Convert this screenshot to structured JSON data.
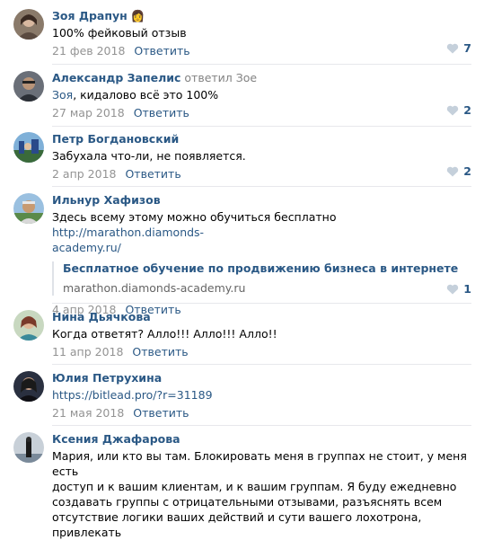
{
  "comments": [
    {
      "author": "Зоя Драпун",
      "author_emoji": "👩",
      "reply_to": "",
      "text_prefix": "",
      "text": "100% фейковый отзыв",
      "date": "21 фев 2018",
      "reply_label": "Ответить",
      "likes": "7"
    },
    {
      "author": "Александр Запелис",
      "reply_to": "ответил Зое",
      "text_prefix": "Зоя",
      "text": ", кидалово всё это 100%",
      "date": "27 мар 2018",
      "reply_label": "Ответить",
      "likes": "2"
    },
    {
      "author": "Петр Богдановский",
      "reply_to": "",
      "text_prefix": "",
      "text": "Забухала что-ли, не появляется.",
      "date": "2 апр 2018",
      "reply_label": "Ответить",
      "likes": "2"
    },
    {
      "author": "Ильнур Хафизов",
      "reply_to": "",
      "text_prefix": "",
      "text": "Здесь всему этому можно обучиться бесплатно ",
      "text_link_1": "http://marathon.diamonds-",
      "text_link_2": "academy.ru/",
      "snippet_title": "Бесплатное обучение по продвижению бизнеса в интернете",
      "snippet_domain": "marathon.diamonds-academy.ru",
      "date": "4 апр 2018",
      "reply_label": "Ответить",
      "likes": "1"
    },
    {
      "author": "Нина Дьячкова",
      "reply_to": "",
      "text_prefix": "",
      "text": "Когда ответят? Алло!!! Алло!!! Алло!!",
      "date": "11 апр 2018",
      "reply_label": "Ответить",
      "likes": ""
    },
    {
      "author": "Юлия Петрухина",
      "reply_to": "",
      "text_prefix": "",
      "text_link": "https://bitlead.pro/?r=31189",
      "date": "21 мая 2018",
      "reply_label": "Ответить",
      "likes": ""
    },
    {
      "author": "Ксения Джафарова",
      "reply_to": "",
      "text_lines": [
        "Мария, или кто вы там. Блокировать меня в группах не стоит, у меня есть",
        "доступ и к вашим клиентам, и к вашим группам. Я буду ежедневно",
        "создавать группы с отрицательными отзывами, разъяснять всем",
        "отсутствие логики ваших действий и сути вашего лохотрона, привлекать"
      ]
    }
  ],
  "colors": {
    "link": "#2a5885",
    "meta": "#939393",
    "divider": "#e7e8ec"
  },
  "icons": {
    "like": "heart-icon"
  }
}
